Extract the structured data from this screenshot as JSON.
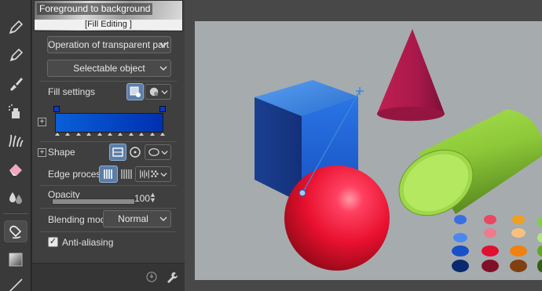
{
  "sub_tool": {
    "name": "Foreground to background",
    "caption": "[Fill Editing ]"
  },
  "settings": {
    "operation": "Operation of transparent part",
    "target": "Selectable object",
    "fill_settings_label": "Fill settings",
    "shape_label": "Shape",
    "edge_process_label": "Edge process",
    "opacity_label": "Opacity",
    "opacity_value": "100",
    "opacity_fraction": 1.0,
    "blending_mode_label": "Blending mode",
    "blending_mode_value": "Normal",
    "anti_aliasing_label": "Anti-aliasing",
    "anti_aliasing_checked": true
  },
  "gradient": {
    "start_color": "#0a5fd8",
    "end_color": "#0030b0"
  },
  "tools": [
    {
      "name": "pen-tool-icon",
      "active": false
    },
    {
      "name": "pencil-tool-icon",
      "active": false
    },
    {
      "name": "brush-tool-icon",
      "active": false
    },
    {
      "name": "airbrush-tool-icon",
      "active": false
    },
    {
      "name": "decoration-tool-icon",
      "active": false
    },
    {
      "name": "eraser-tool-icon",
      "active": false
    },
    {
      "name": "blend-tool-icon",
      "active": false
    },
    {
      "name": "fill-tool-icon",
      "active": true
    },
    {
      "name": "gradient-tool-icon",
      "active": false
    },
    {
      "name": "line-tool-icon",
      "active": false
    }
  ],
  "colors": {
    "accent_selected": "#5b7ea8",
    "canvas_bg": "#a6abae"
  }
}
